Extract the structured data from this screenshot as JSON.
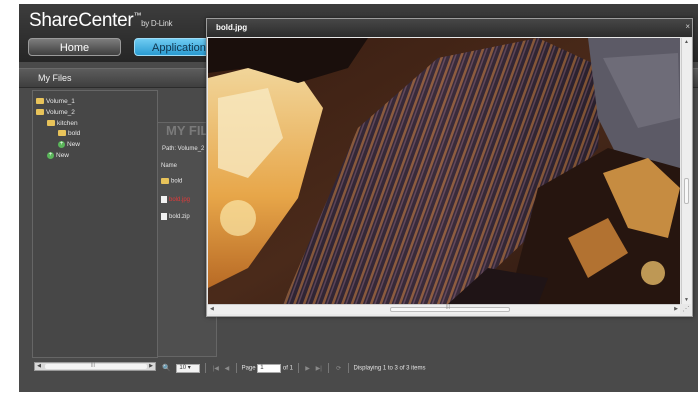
{
  "brand": {
    "name": "ShareCenter",
    "tm": "™",
    "by": "by D-Link"
  },
  "nav": {
    "home": "Home",
    "applications": "Applications"
  },
  "panel": {
    "title": "My Files"
  },
  "tree": {
    "items": [
      "Volume_1",
      "Volume_2",
      "kitchen",
      "bold",
      "New",
      "New"
    ]
  },
  "listing": {
    "heading": "MY FILES",
    "path": "Path:  Volume_2",
    "name_header": "Name",
    "files": [
      "bold",
      "bold.jpg",
      "bold.zip"
    ]
  },
  "pager": {
    "page_size": "10",
    "page_label": "Page",
    "page_value": "1",
    "of_label": "of 1",
    "status": "Displaying 1 to 3 of 3 items"
  },
  "viewer": {
    "title": "bold.jpg",
    "close": "×"
  },
  "colors": {
    "accent": "#2a9bd2",
    "selected_file": "#e23a3a",
    "folder": "#e8c35a"
  }
}
